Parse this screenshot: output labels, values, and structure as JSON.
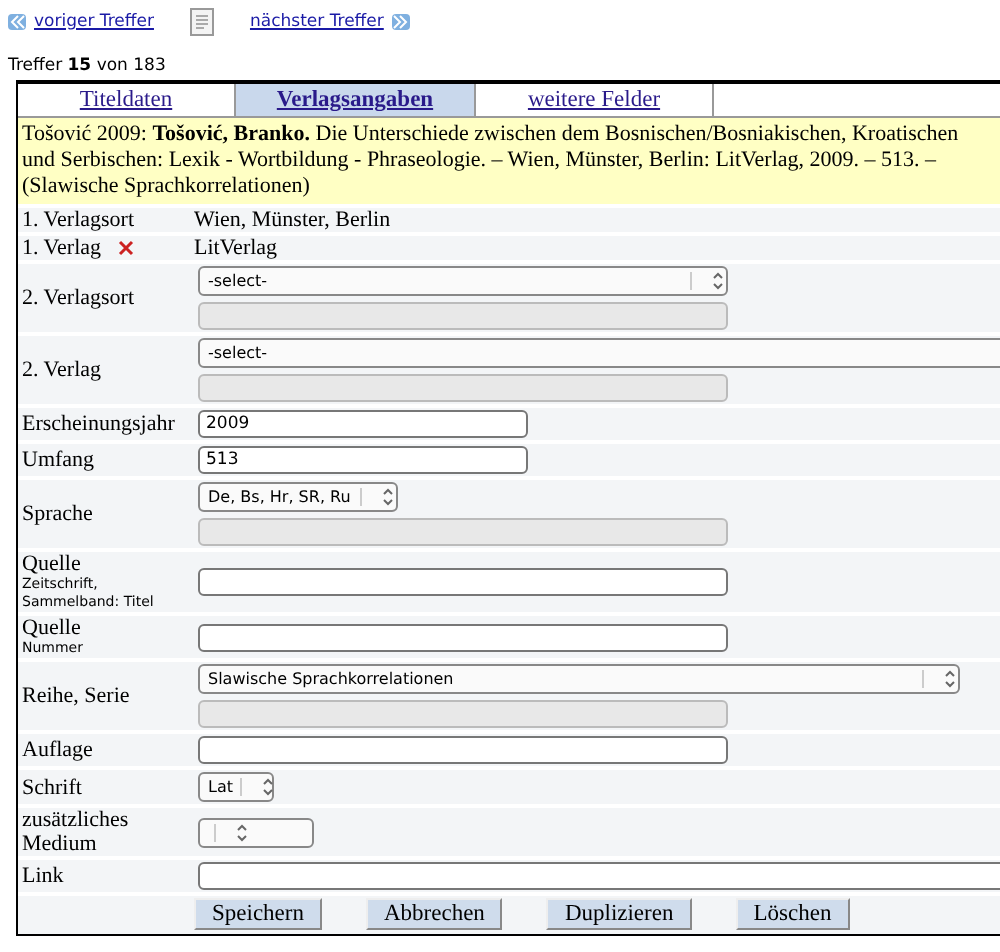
{
  "nav": {
    "previous": "voriger Treffer",
    "next": "nächster Treffer"
  },
  "counter": {
    "prefix": "Treffer",
    "current": "15",
    "middle": "von",
    "total": "183"
  },
  "tabs": [
    {
      "label": "Titeldaten",
      "selected": false
    },
    {
      "label": "Verlagsangaben",
      "selected": true
    },
    {
      "label": "weitere Felder",
      "selected": false
    }
  ],
  "citation": "Tošović 2009: **Tošović, Branko.** Die Unterschiede zwischen dem Bosnischen/Bosniakischen, Kroatischen und Serbischen: Lexik - Wortbildung - Phraseologie. – Wien, Münster, Berlin: LitVerlag, 2009. – 513. – (Slawische Sprachkorrelationen)",
  "rows": [
    {
      "kind": "static",
      "label": "1. Verlagsort",
      "value": "Wien, Münster, Berlin",
      "removable": false
    },
    {
      "kind": "static",
      "label": "1. Verlag",
      "value": "LitVerlag",
      "removable": true
    },
    {
      "kind": "select_extra",
      "label": "2. Verlagsort",
      "value": "-select-"
    },
    {
      "kind": "select_extra",
      "label": "2. Verlag",
      "value": "-select-"
    },
    {
      "kind": "input",
      "label": "Erscheinungsjahr",
      "value": "2009"
    },
    {
      "kind": "input",
      "label": "Umfang",
      "value": "513"
    },
    {
      "kind": "select_extra",
      "label": "Sprache",
      "value": "De, Bs, Hr, SR, Ru"
    },
    {
      "kind": "input",
      "label": "Quelle",
      "sublabel": "Zeitschrift, Sammelband: Titel",
      "value": ""
    },
    {
      "kind": "input",
      "label": "Quelle",
      "sublabel": "Nummer",
      "value": ""
    },
    {
      "kind": "select_extra",
      "label": "Reihe, Serie",
      "value": "Slawische Sprachkorrelationen"
    },
    {
      "kind": "input",
      "label": "Auflage",
      "value": ""
    },
    {
      "kind": "select",
      "label": "Schrift",
      "value": "Lat"
    },
    {
      "kind": "select",
      "label": "zusätzliches Medium",
      "value": ""
    },
    {
      "kind": "input",
      "label": "Link",
      "value": ""
    }
  ],
  "buttons": [
    "Speichern",
    "Abbrechen",
    "Duplizieren",
    "Löschen"
  ]
}
